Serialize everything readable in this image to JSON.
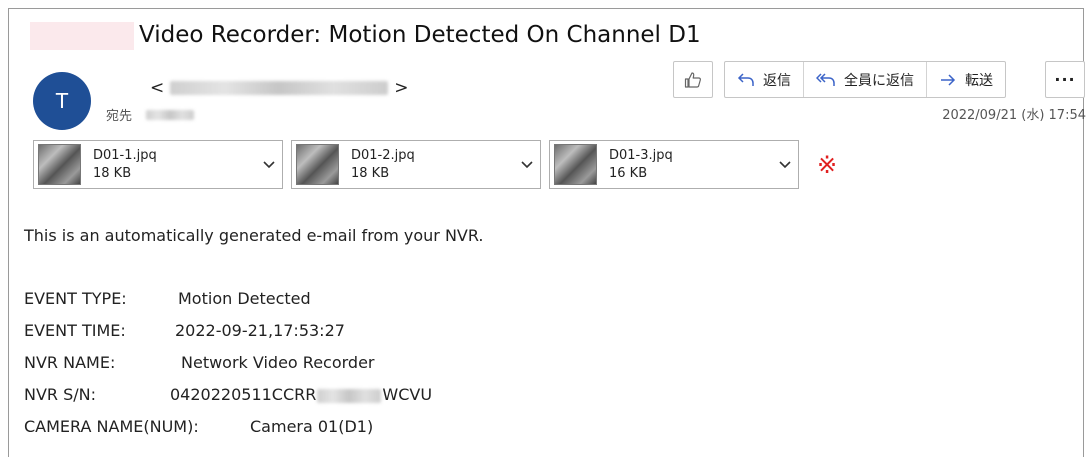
{
  "subject": "Video Recorder: Motion Detected On Channel D1",
  "sender": {
    "avatar_letter": "T",
    "open_bracket": "<",
    "close_bracket": ">",
    "to_label": "宛先"
  },
  "toolbar": {
    "like_icon": "thumbs-up-icon",
    "reply_icon": "reply-icon",
    "reply_label": "返信",
    "reply_all_icon": "reply-all-icon",
    "reply_all_label": "全員に返信",
    "forward_icon": "forward-icon",
    "forward_label": "転送",
    "more_label": "···"
  },
  "datetime": "2022/09/21 (水) 17:54",
  "attachments": [
    {
      "name": "D01-1.jpq",
      "size": "18 KB"
    },
    {
      "name": "D01-2.jpq",
      "size": "18 KB"
    },
    {
      "name": "D01-3.jpq",
      "size": "16 KB"
    }
  ],
  "note_mark": "※",
  "body": {
    "intro": "This is an automatically generated e-mail from your NVR.",
    "fields": [
      {
        "label": "EVENT TYPE:",
        "value": "Motion Detected"
      },
      {
        "label": "EVENT TIME:",
        "value": "2022-09-21,17:53:27"
      },
      {
        "label": "NVR NAME:",
        "value": "Network Video Recorder"
      },
      {
        "label": "NVR S/N:",
        "value_prefix": "0420220511CCRR",
        "value_suffix": "WCVU"
      },
      {
        "label": "CAMERA NAME(NUM):",
        "value": "Camera 01(D1)"
      }
    ]
  },
  "colors": {
    "avatar": "#1f4f96",
    "accent_icon": "#3c64c8",
    "mark": "#e02020"
  }
}
